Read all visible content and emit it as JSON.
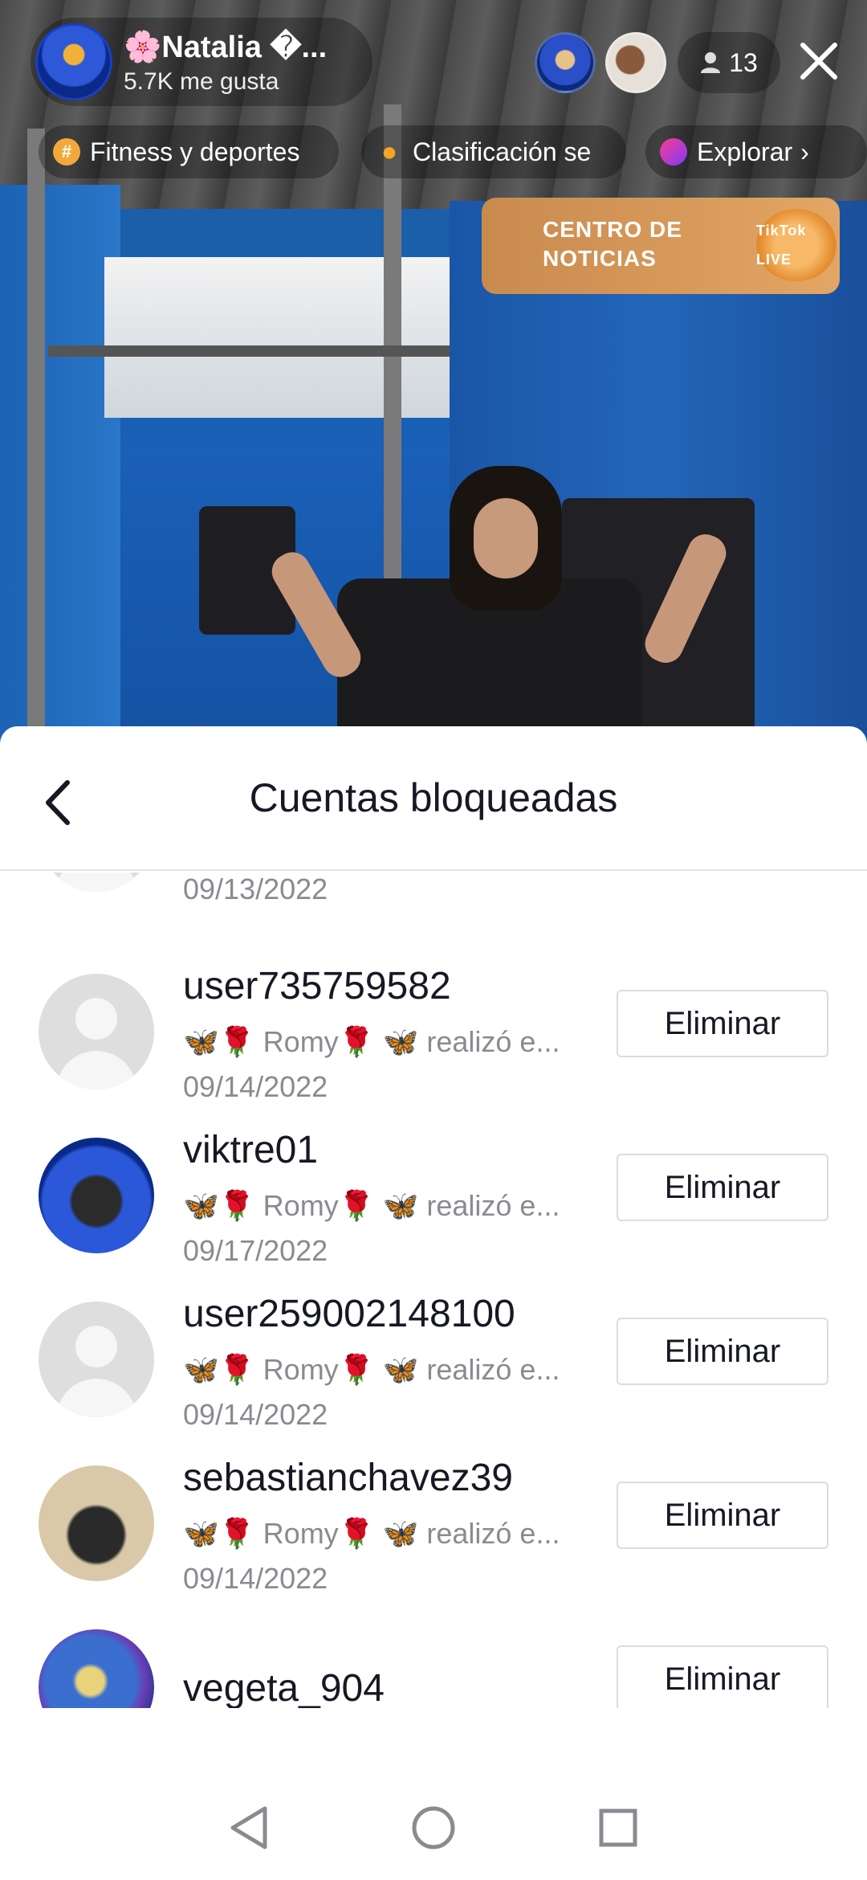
{
  "stream": {
    "host_name": "🌸Natalia �...",
    "host_likes": "5.7K me gusta",
    "viewer_count": "13",
    "chips": [
      {
        "label": "Fitness y deportes",
        "icon": "hashtag-icon"
      },
      {
        "label": "Clasificación se",
        "icon": "flame-icon"
      },
      {
        "label": "Explorar",
        "icon": "explore-icon"
      }
    ],
    "news_banner": {
      "line1": "CENTRO DE",
      "line2": "NOTICIAS",
      "logo": "TikTok LIVE"
    }
  },
  "sheet": {
    "title": "Cuentas bloqueadas",
    "remove_label": "Eliminar",
    "partial_top_date": "09/13/2022",
    "rows": [
      {
        "username": "user735759582",
        "desc_name": "Romy",
        "desc_suffix": "realizó e...",
        "date": "09/14/2022",
        "avatar": "default"
      },
      {
        "username": "viktre01",
        "desc_name": "Romy",
        "desc_suffix": "realizó e...",
        "date": "09/17/2022",
        "avatar": "photo-blue"
      },
      {
        "username": "user259002148100",
        "desc_name": "Romy",
        "desc_suffix": "realizó e...",
        "date": "09/14/2022",
        "avatar": "default"
      },
      {
        "username": "sebastianchavez39",
        "desc_name": "Romy",
        "desc_suffix": "realizó e...",
        "date": "09/14/2022",
        "avatar": "photo-beige"
      },
      {
        "username": "vegeta_904",
        "desc_name": "",
        "desc_suffix": "",
        "date": "",
        "avatar": "photo-anime"
      }
    ]
  },
  "colors": {
    "text_primary": "#161823",
    "text_secondary": "#8a8b91",
    "border": "#dcdcdc"
  }
}
